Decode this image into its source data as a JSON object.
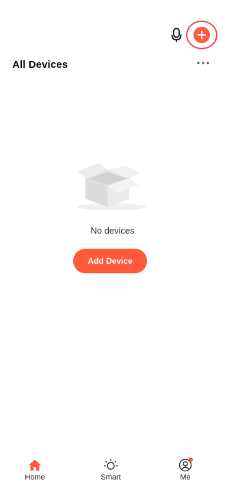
{
  "header": {
    "title": "All Devices",
    "mic_icon": "microphone-icon",
    "add_icon": "plus-circle-icon",
    "more_icon": "more-horizontal-icon"
  },
  "empty_state": {
    "illustration": "open-box-icon",
    "message": "No devices",
    "button_label": "Add Device"
  },
  "bottom_nav": {
    "items": [
      {
        "label": "Home",
        "icon": "home-icon",
        "active": true
      },
      {
        "label": "Smart",
        "icon": "sun-icon",
        "active": false
      },
      {
        "label": "Me",
        "icon": "user-icon",
        "active": false,
        "badge": true
      }
    ]
  },
  "colors": {
    "accent": "#ff5a3c",
    "highlight_ring": "#f0505d",
    "text": "#111111",
    "inactive_icon": "#333333"
  }
}
